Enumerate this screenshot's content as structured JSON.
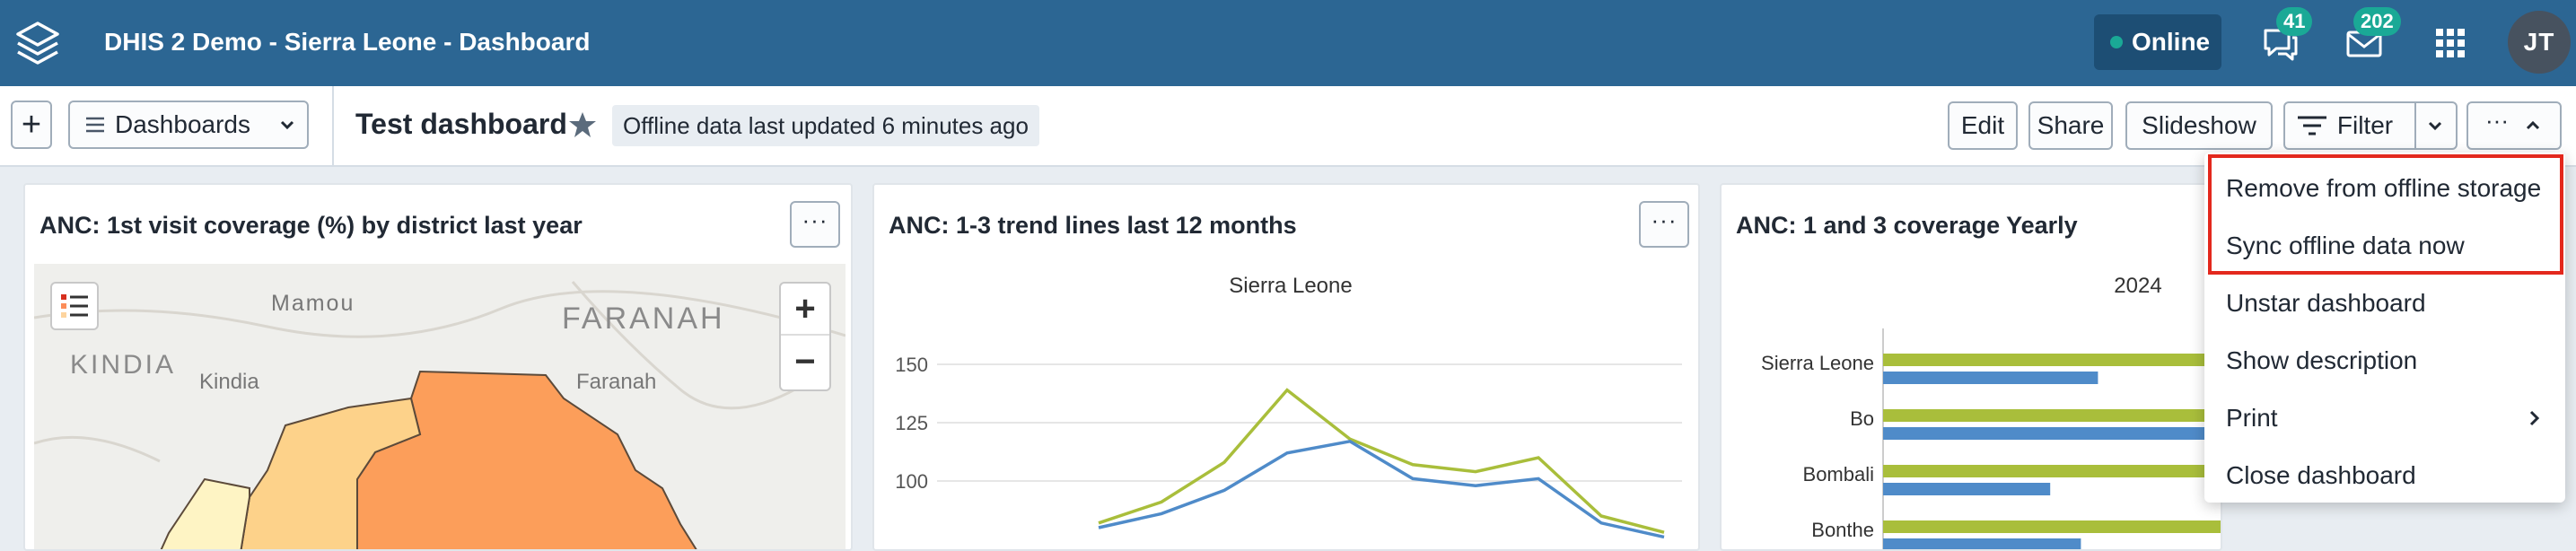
{
  "header": {
    "title": "DHIS 2 Demo - Sierra Leone - Dashboard",
    "status": "Online",
    "interpretations_count": "41",
    "messages_count": "202",
    "user_initials": "JT"
  },
  "toolbar": {
    "add_label": "+",
    "dashboards_label": "Dashboards",
    "dashboard_title": "Test dashboard",
    "offline_status": "Offline data last updated 6 minutes ago",
    "edit_label": "Edit",
    "share_label": "Share",
    "slideshow_label": "Slideshow",
    "filter_label": "Filter",
    "more_label": "···"
  },
  "menu": {
    "items": [
      {
        "label": "Remove from offline storage"
      },
      {
        "label": "Sync offline data now"
      },
      {
        "label": "Unstar dashboard"
      },
      {
        "label": "Show description"
      },
      {
        "label": "Print"
      },
      {
        "label": "Close dashboard"
      }
    ]
  },
  "cards": [
    {
      "title": "ANC: 1st visit coverage (%) by district last year",
      "map_labels": {
        "mamou": "Mamou",
        "faranah_region": "FARANAH",
        "kindia_region": "KINDIA",
        "kindia_town": "Kindia",
        "faranah_town": "Faranah"
      },
      "zoom_in": "+",
      "zoom_out": "−"
    },
    {
      "title": "ANC: 1-3 trend lines last 12 months",
      "chart_title": "Sierra Leone"
    },
    {
      "title": "ANC: 1 and 3 coverage Yearly",
      "chart_title": "2024"
    }
  ],
  "chart_data": [
    {
      "type": "line",
      "title": "Sierra Leone",
      "yticks": [
        100,
        125,
        150
      ],
      "ylim": [
        95,
        155
      ],
      "series": [
        {
          "color": "#a9be3b",
          "values": [
            82,
            91,
            108,
            139,
            118,
            107,
            104,
            110,
            85,
            78
          ]
        },
        {
          "color": "#4f8bc9",
          "values": [
            80,
            86,
            96,
            112,
            117,
            101,
            98,
            101,
            82,
            76
          ]
        }
      ],
      "colors": {
        "green": "#a9be3b",
        "blue": "#4f8bc9"
      }
    },
    {
      "type": "bar",
      "orientation": "horizontal",
      "title": "2024",
      "categories": [
        "Sierra Leone",
        "Bo",
        "Bombali",
        "Bonthe"
      ],
      "series": [
        {
          "color": "#a9be3b",
          "values": [
            100,
            100,
            100,
            100
          ]
        },
        {
          "color": "#4f8bc9",
          "values": [
            63,
            100,
            49,
            58
          ]
        }
      ],
      "xlim": [
        0,
        100
      ]
    }
  ],
  "colors": {
    "header": "#2c6693",
    "accent": "#1aa996",
    "highlight": "#e3281d"
  }
}
